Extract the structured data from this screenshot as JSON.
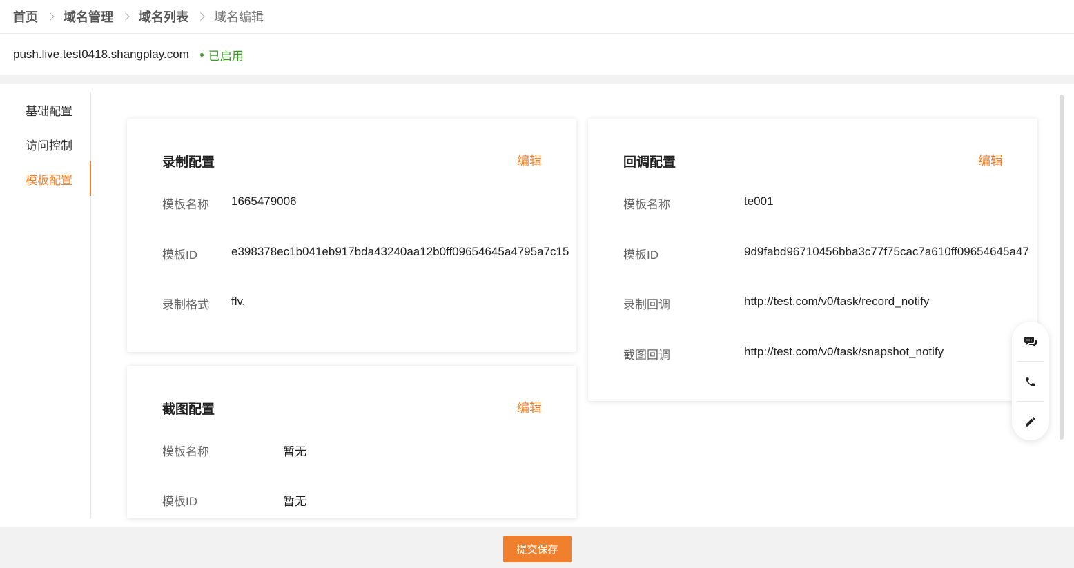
{
  "breadcrumb": {
    "items": [
      "首页",
      "域名管理",
      "域名列表",
      "域名编辑"
    ]
  },
  "domain": {
    "name": "push.live.test0418.shangplay.com",
    "status": "已启用",
    "status_color": "#3d9b27"
  },
  "sidenav": {
    "items": [
      "基础配置",
      "访问控制",
      "模板配置"
    ],
    "active": "模板配置"
  },
  "record_config": {
    "title": "录制配置",
    "edit_label": "编辑",
    "rows": [
      {
        "label": "模板名称",
        "value": "1665479006"
      },
      {
        "label": "模板ID",
        "value": "e398378ec1b041eb917bda43240aa12b0ff09654645a4795a7c15"
      },
      {
        "label": "录制格式",
        "value": "flv,"
      }
    ]
  },
  "snapshot_config": {
    "title": "截图配置",
    "edit_label": "编辑",
    "rows": [
      {
        "label": "模板名称",
        "value": "暂无"
      },
      {
        "label": "模板ID",
        "value": "暂无"
      }
    ]
  },
  "callback_config": {
    "title": "回调配置",
    "edit_label": "编辑",
    "rows": [
      {
        "label": "模板名称",
        "value": "te001"
      },
      {
        "label": "模板ID",
        "value": "9d9fabd96710456bba3c77f75cac7a610ff09654645a47"
      },
      {
        "label": "录制回调",
        "value": "http://test.com/v0/task/record_notify"
      },
      {
        "label": "截图回调",
        "value": "http://test.com/v0/task/snapshot_notify"
      }
    ]
  },
  "float_tools": [
    "chat-icon",
    "phone-icon",
    "pencil-icon"
  ],
  "footer": {
    "submit_label": "提交保存"
  },
  "colors": {
    "accent": "#f0802d"
  }
}
